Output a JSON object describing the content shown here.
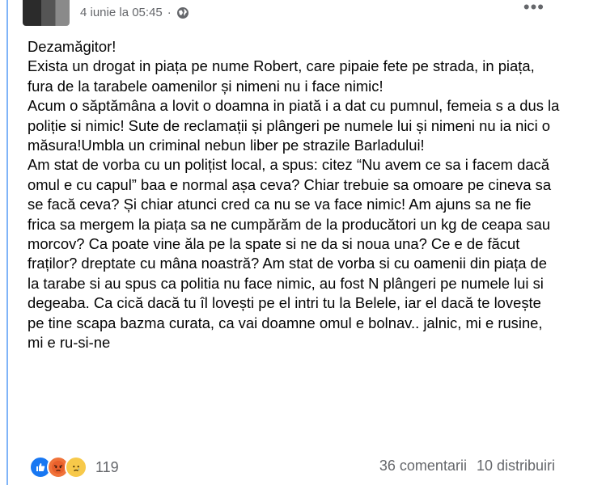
{
  "post": {
    "timestamp": "4 iunie la 05:45",
    "separator": "·",
    "privacy_icon": "globe-icon",
    "more_icon": "more-dots-icon",
    "more_label": "•••",
    "paragraphs": [
      "Dezamăgitor!",
      "Exista un drogat in piața pe nume Robert, care pipaie fete pe strada, in piața, fura de la tarabele oamenilor și nimeni nu i face nimic!",
      "Acum o săptămâna a lovit o doamna in piată i a dat cu pumnul, femeia s a dus la poliție si nimic! Sute de reclamații și plângeri pe numele lui și nimeni nu ia nici o măsura!Umbla un criminal nebun liber pe strazile Barladului!",
      "Am stat de vorba cu un polițist local, a spus: citez “Nu avem ce sa i facem dacă omul e cu capul” baa e normal așa ceva? Chiar trebuie sa omoare pe cineva sa se facă ceva? Și chiar atunci cred ca nu se va face nimic! Am ajuns sa ne fie frica sa mergem la piața sa ne cumpărăm de la producători un kg de ceapa sau morcov? Ca poate vine ăla pe la spate si ne da si noua una? Ce e de făcut fraților? dreptate cu mâna noastră? Am stat de vorba si cu oamenii din piața de la tarabe si au spus ca politia nu face nimic, au fost N plângeri pe numele lui si degeaba. Ca cică dacă tu îl lovești pe el intri tu la Belele, iar el dacă te lovește pe tine scapa bazma curata, ca vai doamne omul e bolnav.. jalnic, mi e rusine, mi e ru-si-ne"
    ]
  },
  "footer": {
    "reactions": [
      "like",
      "angry",
      "sad"
    ],
    "reaction_icons": [
      "like-icon",
      "angry-icon",
      "sad-icon"
    ],
    "reaction_count": "119",
    "comments": "36 comentarii",
    "shares": "10 distribuiri"
  },
  "colors": {
    "accent": "#1877f2",
    "muted_text": "#65676b",
    "body_text": "#050505"
  }
}
